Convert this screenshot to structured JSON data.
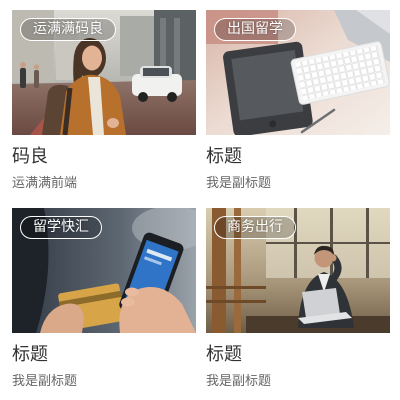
{
  "cards": [
    {
      "tag": "运满满码良",
      "title": "码良",
      "subtitle": "运满满前端"
    },
    {
      "tag": "出国留学",
      "title": "标题",
      "subtitle": "我是副标题"
    },
    {
      "tag": "留学快汇",
      "title": "标题",
      "subtitle": "我是副标题"
    },
    {
      "tag": "商务出行",
      "title": "标题",
      "subtitle": "我是副标题"
    }
  ]
}
